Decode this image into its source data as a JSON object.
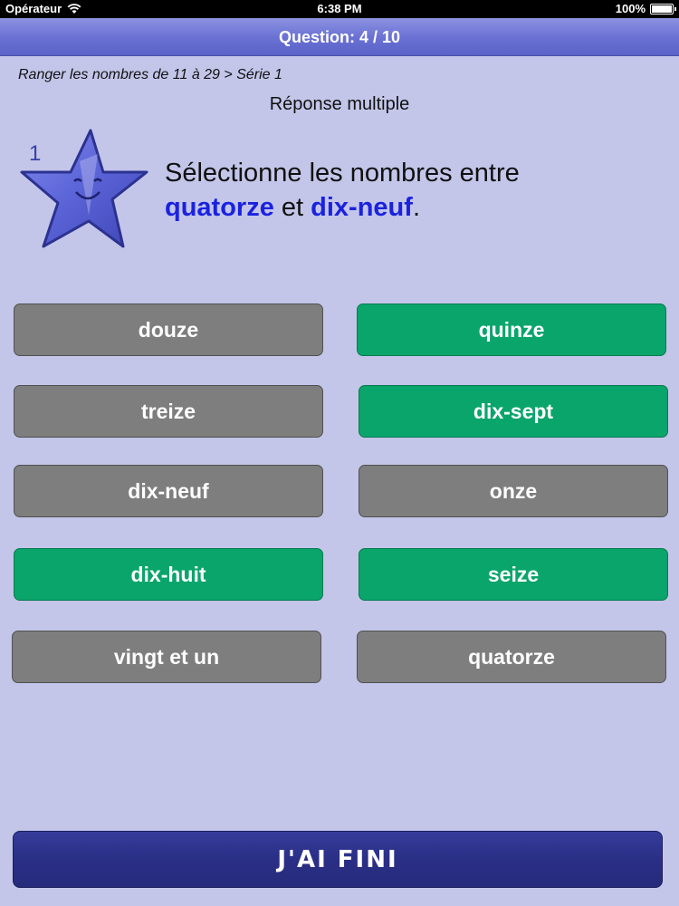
{
  "statusbar": {
    "carrier": "Opérateur",
    "time": "6:38 PM",
    "battery": "100%"
  },
  "navbar": {
    "title": "Question: 4 / 10"
  },
  "breadcrumb": "Ranger les nombres de 11 à 29 > Série 1",
  "mode": "Réponse multiple",
  "star": {
    "number": "1"
  },
  "question": {
    "prefix": "Sélectionne les nombres entre",
    "term1": "quatorze",
    "mid": "et",
    "term2": "dix-neuf",
    "suffix": "."
  },
  "answers": [
    {
      "label": "douze",
      "selected": false
    },
    {
      "label": "quinze",
      "selected": true
    },
    {
      "label": "treize",
      "selected": false
    },
    {
      "label": "dix-sept",
      "selected": true
    },
    {
      "label": "dix-neuf",
      "selected": false
    },
    {
      "label": "onze",
      "selected": false
    },
    {
      "label": "dix-huit",
      "selected": true
    },
    {
      "label": "seize",
      "selected": true
    },
    {
      "label": "vingt et un",
      "selected": false
    },
    {
      "label": "quatorze",
      "selected": false
    }
  ],
  "finish_label": "J'AI FINI",
  "colors": {
    "background": "#c3c6e9",
    "selected": "#0aa56b",
    "unselected": "#7e7e7e",
    "highlight": "#1a22e0"
  }
}
